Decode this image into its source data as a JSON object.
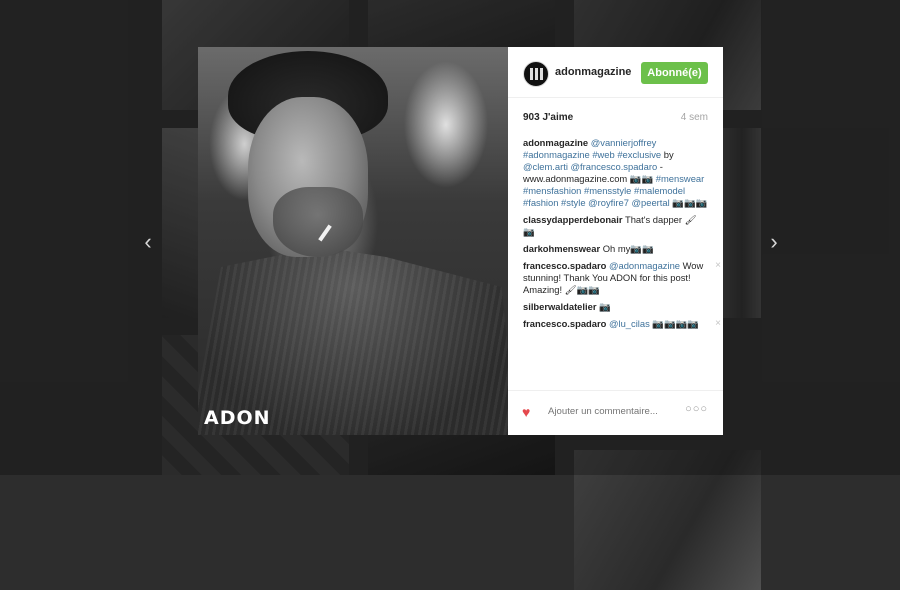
{
  "post": {
    "username": "adonmagazine",
    "follow_label": "Abonné(e)",
    "likes": "903 J'aime",
    "time": "4 sem",
    "photo_logo": "ADON",
    "caption": {
      "user": "adonmagazine",
      "t1": "@vannierjoffrey",
      "t2": "#adonmagazine #web #exclusive",
      "t3": " by ",
      "t4": "@clem.arti @francesco.spadaro",
      "t5": " - www.adonmagazine.com 📷📷 ",
      "t6": "#menswear #mensfashion #mensstyle #malemodel #fashion #style @royfire7 @peertal",
      "t7": " 📷📷📷"
    },
    "comments": [
      {
        "user": "classydapperdebonair",
        "text": "That's dapper 🖌📷"
      },
      {
        "user": "darkohmenswear",
        "text": "Oh my📷📷"
      },
      {
        "user": "francesco.spadaro",
        "tag": "@adonmagazine",
        "text": "Wow stunning! Thank You ADON for this post! Amazing! 🖌📷📷"
      },
      {
        "user": "silberwaldatelier",
        "text": "📷"
      },
      {
        "user": "francesco.spadaro",
        "tag": "@lu_cilas",
        "text": "📷📷📷📷"
      }
    ],
    "comment_placeholder": "Ajouter un commentaire...",
    "more_label": "○○○",
    "delete_icon": "×"
  },
  "nav": {
    "prev": "‹",
    "next": "›"
  },
  "colors": {
    "follow": "#6cc04a",
    "link": "#3f729b",
    "heart": "#e5484d"
  }
}
